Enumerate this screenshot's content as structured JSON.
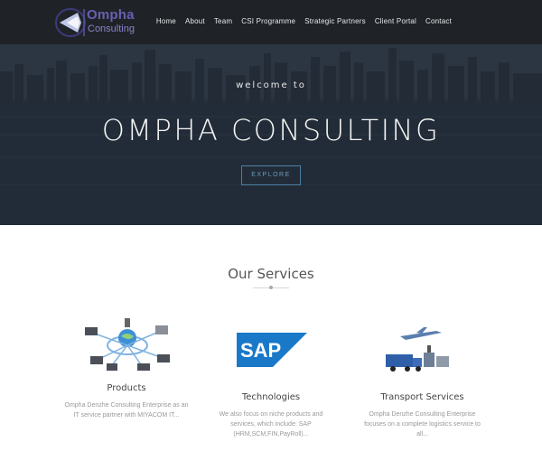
{
  "brand": {
    "line1": "Ompha",
    "line2": "Consulting"
  },
  "nav": {
    "items": [
      "Home",
      "About",
      "Team",
      "CSI Programme",
      "Strategic Partners",
      "Client Portal",
      "Contact"
    ]
  },
  "hero": {
    "welcome": "welcome to",
    "title": "OMPHA CONSULTING",
    "button": "EXPLORE"
  },
  "services": {
    "heading": "Our Services",
    "items": [
      {
        "title": "Products",
        "desc_line1": "Ompha Denzhe Consulting Enterprise as an",
        "desc_line2": "IT service partner with MIYACOM IT..."
      },
      {
        "title": "Technologies",
        "desc_line1": "We also focus on niche products and",
        "desc_line2": "services, which include: SAP",
        "desc_line3": "(HRM,SCM,FIN,PayRoll)..."
      },
      {
        "title": "Transport Services",
        "desc_line1": "Ompha Denzhe Consulting Enterprise",
        "desc_line2": "focuses on a complete logistics service to",
        "desc_line3": "all..."
      }
    ],
    "sap_logo_text": "SAP"
  },
  "colors": {
    "header_bg": "#1f2328",
    "brand_purple": "#6b5fb0",
    "explore_border": "#4f7fa5",
    "sap_blue": "#1a78c8"
  }
}
